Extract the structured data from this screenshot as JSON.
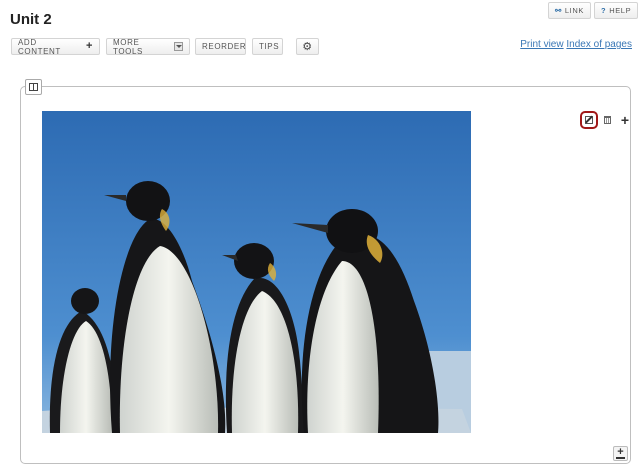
{
  "page": {
    "title": "Unit 2"
  },
  "toolbar": {
    "add_content": "ADD CONTENT",
    "more_tools": "MORE TOOLS",
    "reorder": "REORDER",
    "tips": "TIPS",
    "add_icon": "plus-icon",
    "more_icon": "dropdown-icon",
    "settings_icon": "gear-icon"
  },
  "top_right": {
    "link_label": "LINK",
    "help_label": "HELP",
    "link_icon": "link-icon",
    "help_icon": "question-icon"
  },
  "links": {
    "print_view": "Print view",
    "index": "Index of pages"
  },
  "section": {
    "column_icon": "columns-icon",
    "image_alt": "Emperor penguins",
    "tools": [
      "edit-icon",
      "trash-icon",
      "plus-icon"
    ],
    "add_bottom_icon": "add-below-icon"
  },
  "colors": {
    "accent_link": "#3a77b5",
    "highlight_border": "#a01818",
    "sky": "#3f7fc4"
  }
}
